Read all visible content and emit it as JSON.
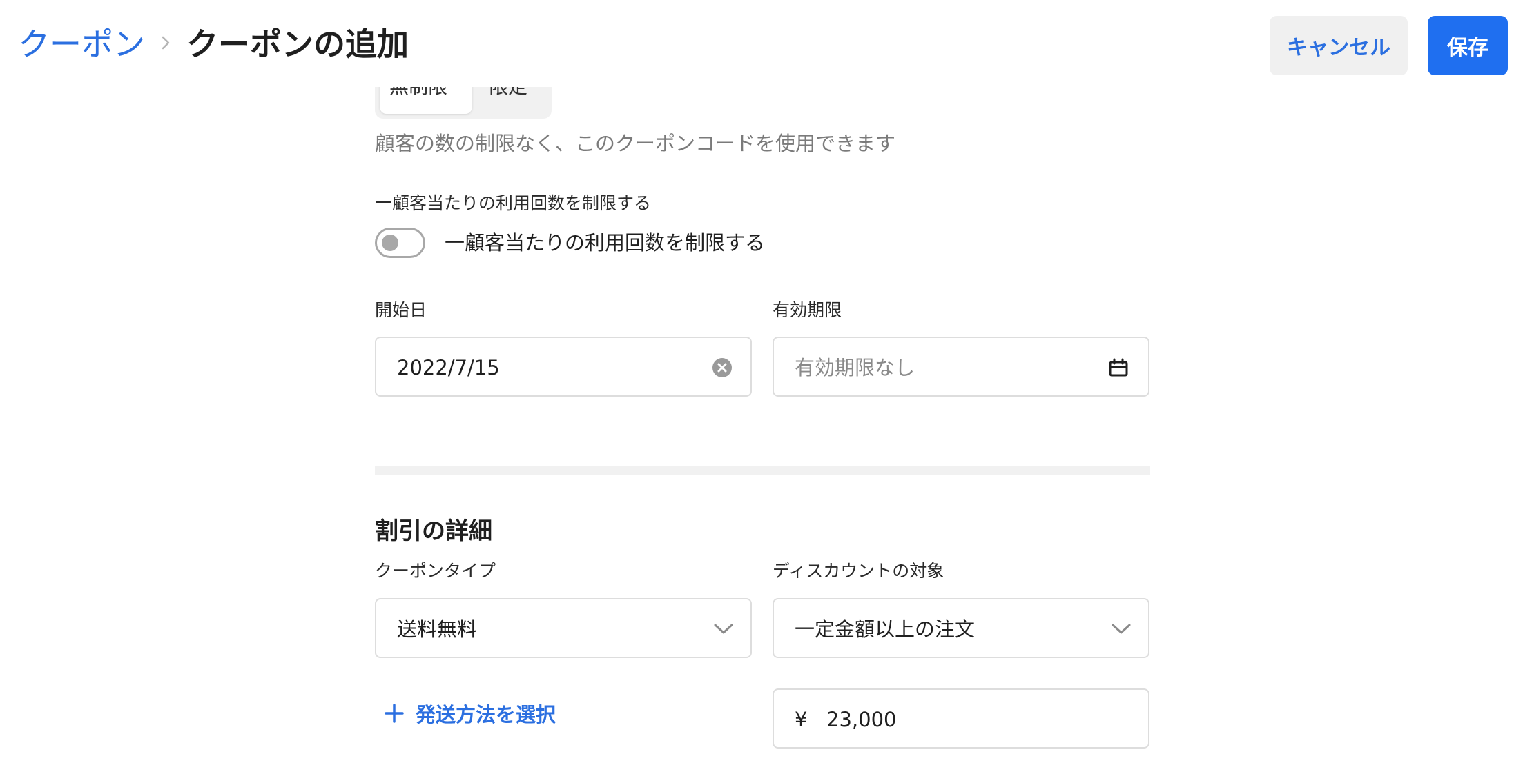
{
  "header": {
    "breadcrumb_link": "クーポン",
    "title": "クーポンの追加",
    "cancel_label": "キャンセル",
    "save_label": "保存"
  },
  "usage": {
    "segment_options": [
      "無制限",
      "限定"
    ],
    "selected_segment": "無制限",
    "helper": "顧客の数の制限なく、このクーポンコードを使用できます"
  },
  "per_customer": {
    "label": "一顧客当たりの利用回数を制限する",
    "toggle_label": "一顧客当たりの利用回数を制限する",
    "toggle_on": false
  },
  "dates": {
    "start_label": "開始日",
    "start_value": "2022/7/15",
    "end_label": "有効期限",
    "end_placeholder": "有効期限なし"
  },
  "discount": {
    "section_title": "割引の詳細",
    "type_label": "クーポンタイプ",
    "type_value": "送料無料",
    "target_label": "ディスカウントの対象",
    "target_value": "一定金額以上の注文",
    "add_shipping_label": "発送方法を選択",
    "currency_symbol": "¥",
    "amount_value": "23,000"
  },
  "colors": {
    "accent": "#1f6ff0",
    "link": "#2b6fe0",
    "muted": "#7a7a7a",
    "border": "#dddddd"
  },
  "icons": [
    "chevron-right-icon",
    "clear-circle-icon",
    "calendar-icon",
    "chevron-down-icon",
    "plus-icon"
  ]
}
